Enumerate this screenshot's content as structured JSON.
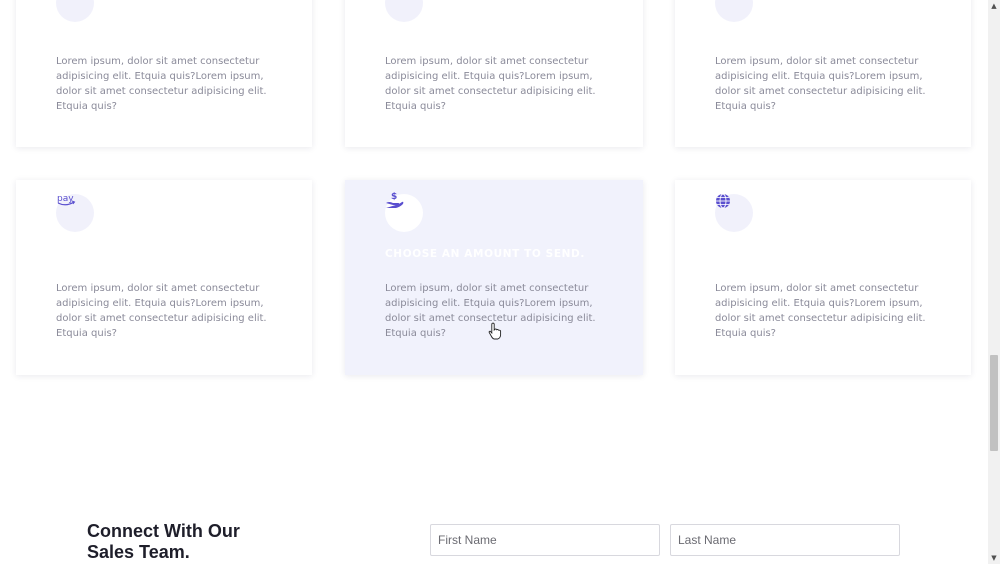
{
  "services": {
    "row1": [
      {
        "body": "Lorem ipsum, dolor sit amet consectetur adipisicing elit. Etquia quis?Lorem ipsum, dolor sit amet consectetur adipisicing elit. Etquia quis?"
      },
      {
        "body": "Lorem ipsum, dolor sit amet consectetur adipisicing elit. Etquia quis?Lorem ipsum, dolor sit amet consectetur adipisicing elit. Etquia quis?"
      },
      {
        "body": "Lorem ipsum, dolor sit amet consectetur adipisicing elit. Etquia quis?Lorem ipsum, dolor sit amet consectetur adipisicing elit. Etquia quis?"
      }
    ],
    "row2": [
      {
        "icon": "amazon-pay-icon",
        "icon_text": "pay",
        "body": "Lorem ipsum, dolor sit amet consectetur adipisicing elit. Etquia quis?Lorem ipsum, dolor sit amet consectetur adipisicing elit. Etquia quis?"
      },
      {
        "icon": "hand-holding-dollar-icon",
        "title": "CHOOSE AN AMOUNT TO SEND.",
        "body": "Lorem ipsum, dolor sit amet consectetur adipisicing elit. Etquia quis?Lorem ipsum, dolor sit amet consectetur adipisicing elit. Etquia quis?"
      },
      {
        "icon": "globe-icon",
        "body": "Lorem ipsum, dolor sit amet consectetur adipisicing elit. Etquia quis?Lorem ipsum, dolor sit amet consectetur adipisicing elit. Etquia quis?"
      }
    ]
  },
  "contact": {
    "heading": "Connect With Our Sales Team.",
    "first_name_placeholder": "First Name",
    "last_name_placeholder": "Last Name"
  },
  "colors": {
    "accent": "#5a4fcf",
    "active_card_bg": "#f1f2fc",
    "heading": "#1e1e2a",
    "body_text": "#8a8a99"
  }
}
